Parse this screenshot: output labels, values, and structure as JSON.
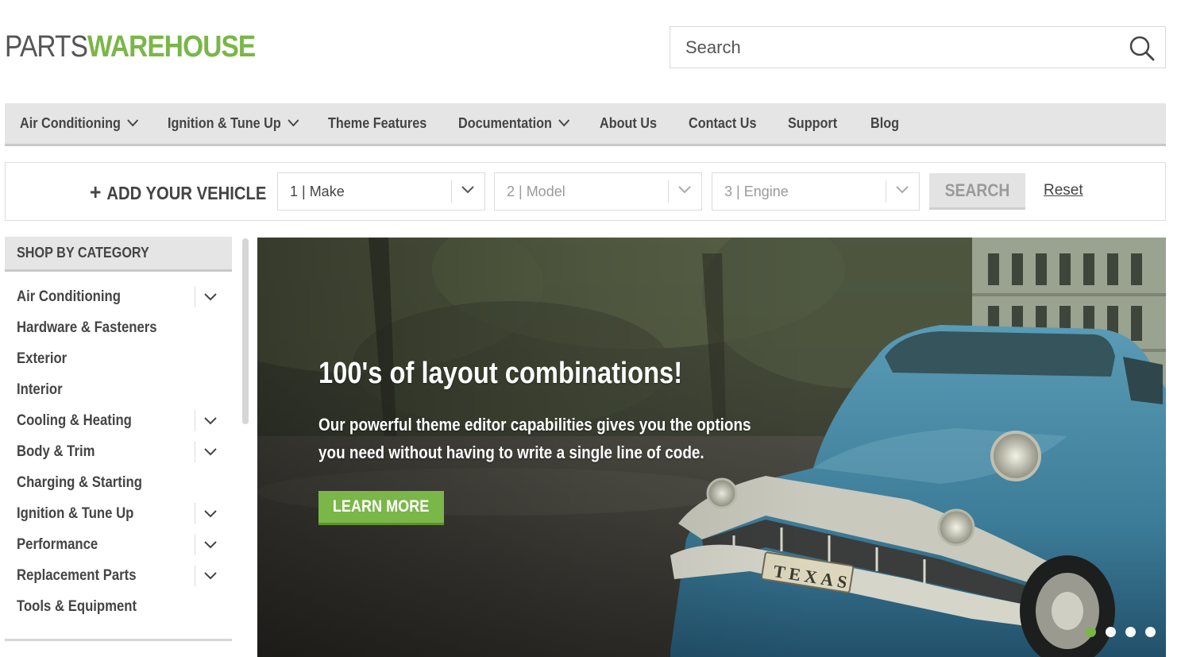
{
  "logo": {
    "part1": "PARTS",
    "part2": "WAREHOUSE"
  },
  "search": {
    "placeholder": "Search"
  },
  "nav": {
    "items": [
      {
        "label": "Air Conditioning",
        "has_dropdown": true
      },
      {
        "label": "Ignition & Tune Up",
        "has_dropdown": true
      },
      {
        "label": "Theme Features",
        "has_dropdown": false
      },
      {
        "label": "Documentation",
        "has_dropdown": true
      },
      {
        "label": "About Us",
        "has_dropdown": false
      },
      {
        "label": "Contact Us",
        "has_dropdown": false
      },
      {
        "label": "Support",
        "has_dropdown": false
      },
      {
        "label": "Blog",
        "has_dropdown": false
      }
    ]
  },
  "vehicle": {
    "add_label": "ADD YOUR VEHICLE",
    "make": "1 | Make",
    "model": "2 | Model",
    "engine": "3 | Engine",
    "search_label": "SEARCH",
    "reset_label": "Reset"
  },
  "sidebar": {
    "title": "SHOP BY CATEGORY",
    "items": [
      {
        "label": "Air Conditioning",
        "expandable": true
      },
      {
        "label": "Hardware & Fasteners",
        "expandable": false
      },
      {
        "label": "Exterior",
        "expandable": false
      },
      {
        "label": "Interior",
        "expandable": false
      },
      {
        "label": "Cooling & Heating",
        "expandable": true
      },
      {
        "label": "Body & Trim",
        "expandable": true
      },
      {
        "label": "Charging & Starting",
        "expandable": false
      },
      {
        "label": "Ignition & Tune Up",
        "expandable": true
      },
      {
        "label": "Performance",
        "expandable": true
      },
      {
        "label": "Replacement Parts",
        "expandable": true
      },
      {
        "label": "Tools & Equipment",
        "expandable": false
      }
    ]
  },
  "hero": {
    "title": "100's of layout combinations!",
    "subtitle_line1": "Our powerful theme editor capabilities gives you the options",
    "subtitle_line2": "you need without having to write a single line of code.",
    "button_label": "LEARN MORE",
    "plate_text": "TEXAS",
    "slide_count": 4,
    "active_slide": 1
  },
  "colors": {
    "brand_green": "#7ab648",
    "logo_gray": "#555555",
    "nav_bg": "#e5e5e5",
    "car_blue": "#3f7d99"
  }
}
